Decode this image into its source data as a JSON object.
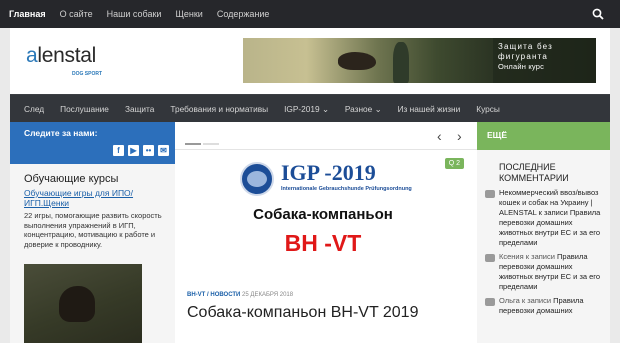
{
  "topnav": {
    "items": [
      "Главная",
      "О сайте",
      "Наши собаки",
      "Щенки",
      "Содержание"
    ]
  },
  "header": {
    "logo_prefix": "a",
    "logo_rest": "lenstal",
    "logo_sub": "DOG SPORT",
    "banner": {
      "line1": "Защита без",
      "line2": "фигуранта",
      "line3": "Онлайн курс"
    }
  },
  "mainnav": {
    "items": [
      "След",
      "Послушание",
      "Защита",
      "Требования и нормативы",
      "IGP-2019",
      "Разное",
      "Из нашей жизни",
      "Курсы"
    ],
    "dropdown_marker": "⌄"
  },
  "left": {
    "follow_title": "Следите за нами:",
    "courses_title": "Обучающие курсы",
    "course_link": "Обучающие игры для ИПО/ИГП.Щенки",
    "course_text": "22 игры, помогающие развить скорость выполнения упражнений в ИГП, концентрацию, мотивацию к работе и доверие к проводнику."
  },
  "slider": {
    "badge": "Q 2",
    "igp_title": "IGP -2019",
    "igp_sub": "Internationale Gebrauchshunde Prüfungsordnung",
    "headline": "Собака-компаньон",
    "red_title": "BH -VT",
    "prev": "‹",
    "next": "›"
  },
  "post": {
    "cat1": "BH-VT",
    "cat2": "НОВОСТИ",
    "date": "25 ДЕКАБРЯ 2018",
    "title": "Собака-компаньон BH-VT 2019"
  },
  "right": {
    "more": "ЕЩЁ",
    "heading": "ПОСЛЕДНИЕ КОММЕНТАРИИ",
    "comments": [
      {
        "who": "",
        "text": "Некоммерческий ввоз/вывоз кошек и собак на Украину | ALENSTAL к записи Правила перевозки домашних животных внутри ЕС и за его пределами"
      },
      {
        "who": "Ксения к записи",
        "text": "Правила перевозки домашних животных внутри ЕС и за его пределами"
      },
      {
        "who": "Ольга к записи",
        "text": "Правила перевозки домашних"
      }
    ]
  },
  "colors": {
    "topbar": "#26272b",
    "mainnav": "#33363b",
    "accent_blue": "#2c6fbb",
    "accent_green": "#7ab55c",
    "accent_red": "#e01818"
  }
}
